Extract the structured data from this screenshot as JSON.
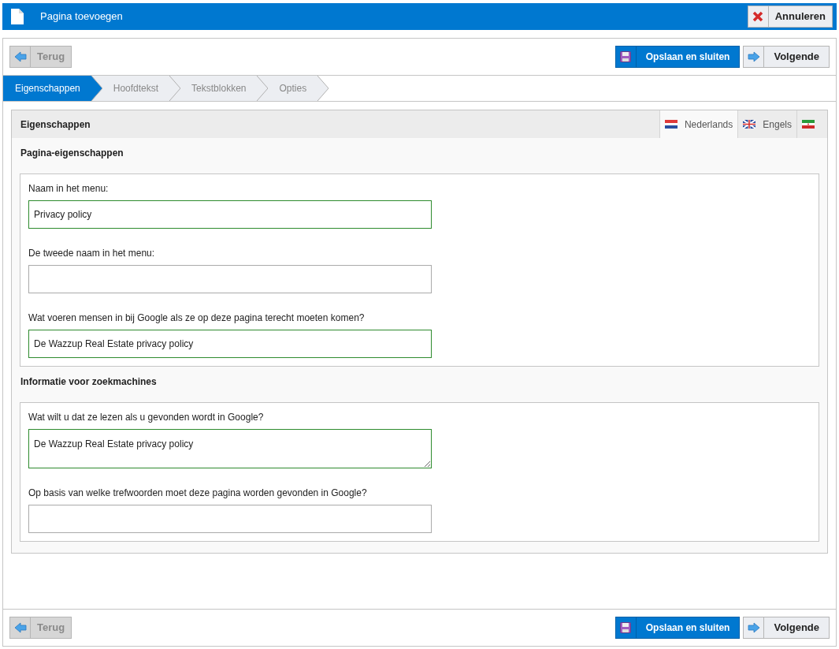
{
  "header": {
    "title": "Pagina toevoegen",
    "cancel": "Annuleren"
  },
  "top_toolbar": {
    "back": {
      "label": "Terug",
      "disabled": true
    },
    "save": "Opslaan en sluiten",
    "next": "Volgende"
  },
  "steps": [
    {
      "label": "Eigenschappen",
      "selected": true
    },
    {
      "label": "Hoofdtekst",
      "selected": false
    },
    {
      "label": "Tekstblokken",
      "selected": false
    },
    {
      "label": "Opties",
      "selected": false
    }
  ],
  "panel": {
    "title": "Eigenschappen",
    "languages": [
      {
        "kind": "nl",
        "label": "Nederlands",
        "selected": true
      },
      {
        "kind": "en",
        "label": "Engels",
        "selected": false
      },
      {
        "kind": "ir",
        "selected": false
      }
    ],
    "sections": [
      {
        "title": "Pagina-eigenschappen",
        "fields": [
          {
            "kind": "input",
            "label": "Naam in het menu:",
            "value": "Privacy policy",
            "valid": true
          },
          {
            "kind": "input",
            "label": "De tweede naam in het menu:",
            "valid": false
          },
          {
            "kind": "input",
            "label": "Wat voeren mensen in bij Google als ze op deze pagina terecht moeten komen?",
            "value": "De Wazzup Real Estate privacy policy",
            "valid": true
          }
        ]
      },
      {
        "title": "Informatie voor zoekmachines",
        "fields": [
          {
            "kind": "textarea",
            "label": "Wat wilt u dat ze lezen als u gevonden wordt in Google?",
            "value": "De Wazzup Real Estate privacy policy",
            "valid": true
          },
          {
            "kind": "input",
            "label": "Op basis van welke trefwoorden moet deze pagina worden gevonden in Google?",
            "valid": false
          }
        ]
      }
    ]
  },
  "bottom_toolbar": {
    "back": {
      "label": "Terug",
      "disabled": true
    },
    "save": "Opslaan en sluiten",
    "next": "Volgende"
  }
}
